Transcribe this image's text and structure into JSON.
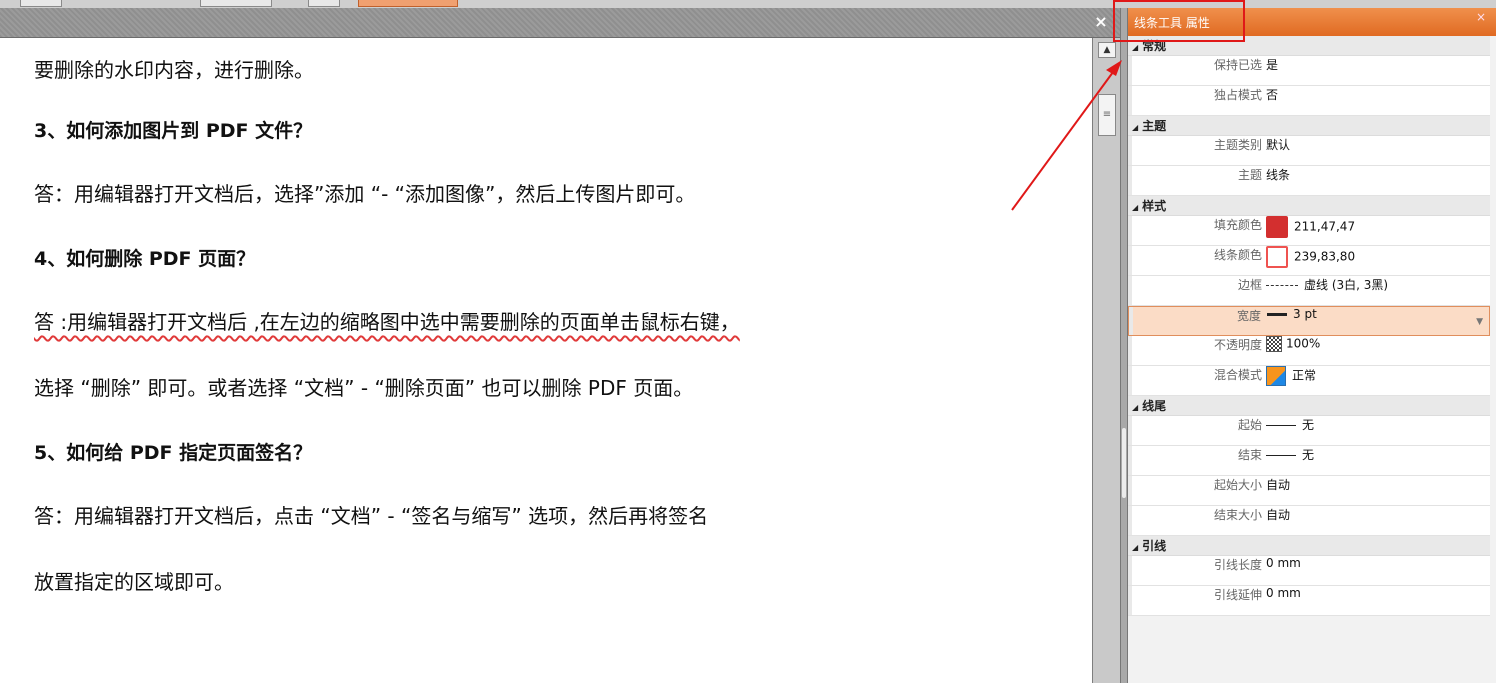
{
  "document": {
    "lines": [
      {
        "text": "要删除的水印内容，进行删除。",
        "style": "body"
      },
      {
        "text": "3、如何添加图片到  PDF  文件？",
        "style": "heading"
      },
      {
        "text": "答：用编辑器打开文档后，选择”添加 “- “添加图像”，然后上传图片即可。",
        "style": "body"
      },
      {
        "text": "4、如何删除  PDF  页面？",
        "style": "heading"
      },
      {
        "text": "答 :用编辑器打开文档后 ,在左边的缩略图中选中需要删除的页面单击鼠标右键，",
        "style": "body spell"
      },
      {
        "text": "选择 “删除” 即可。或者选择 “文档” - “删除页面” 也可以删除 PDF 页面。",
        "style": "body"
      },
      {
        "text": "5、如何给  PDF  指定页面签名？",
        "style": "heading"
      },
      {
        "text": "答：用编辑器打开文档后，点击 “文档” - “签名与缩写” 选项，然后再将签名",
        "style": "body"
      },
      {
        "text": "放置指定的区域即可。",
        "style": "body"
      }
    ],
    "close_label": "×"
  },
  "panel": {
    "title": "线条工具 属性",
    "close_label": "×",
    "categories": [
      {
        "name": "常规",
        "rows": [
          {
            "label": "保持已选",
            "value": "是"
          },
          {
            "label": "独占模式",
            "value": "否"
          }
        ]
      },
      {
        "name": "主题",
        "rows": [
          {
            "label": "主题类别",
            "value": "默认"
          },
          {
            "label": "主题",
            "value": "线条"
          }
        ]
      },
      {
        "name": "样式",
        "rows": [
          {
            "label": "填充颜色",
            "value": "211,47,47",
            "swatch": "fill"
          },
          {
            "label": "线条颜色",
            "value": "239,83,80",
            "swatch": "stroke"
          },
          {
            "label": "边框",
            "value": "虚线 (3白, 3黑)",
            "swatch": "dash"
          },
          {
            "label": "宽度",
            "value": "3 pt",
            "swatch": "thick",
            "selected": true
          },
          {
            "label": "不透明度",
            "value": "100%",
            "swatch": "checker"
          },
          {
            "label": "混合模式",
            "value": "正常",
            "swatch": "blend"
          }
        ]
      },
      {
        "name": "线尾",
        "rows": [
          {
            "label": "起始",
            "value": "无",
            "swatch": "thin"
          },
          {
            "label": "结束",
            "value": "无",
            "swatch": "thin"
          },
          {
            "label": "起始大小",
            "value": "自动"
          },
          {
            "label": "结束大小",
            "value": "自动"
          }
        ]
      },
      {
        "name": "引线",
        "rows": [
          {
            "label": "引线长度",
            "value": "0 mm"
          },
          {
            "label": "引线延伸",
            "value": "0 mm"
          }
        ]
      }
    ]
  },
  "colors": {
    "accent": "#e06a22",
    "highlight_box": "#e01818",
    "fill_color": "#d32f2f",
    "stroke_color": "#ef5350"
  }
}
